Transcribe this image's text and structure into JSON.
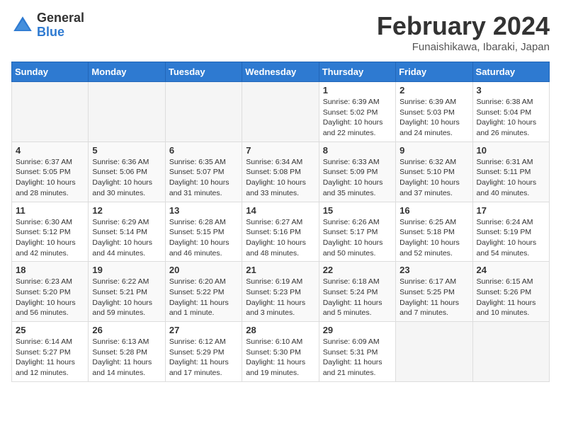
{
  "header": {
    "logo_general": "General",
    "logo_blue": "Blue",
    "month_title": "February 2024",
    "location": "Funaishikawa, Ibaraki, Japan"
  },
  "weekdays": [
    "Sunday",
    "Monday",
    "Tuesday",
    "Wednesday",
    "Thursday",
    "Friday",
    "Saturday"
  ],
  "weeks": [
    [
      {
        "day": "",
        "content": ""
      },
      {
        "day": "",
        "content": ""
      },
      {
        "day": "",
        "content": ""
      },
      {
        "day": "",
        "content": ""
      },
      {
        "day": "1",
        "content": "Sunrise: 6:39 AM\nSunset: 5:02 PM\nDaylight: 10 hours\nand 22 minutes."
      },
      {
        "day": "2",
        "content": "Sunrise: 6:39 AM\nSunset: 5:03 PM\nDaylight: 10 hours\nand 24 minutes."
      },
      {
        "day": "3",
        "content": "Sunrise: 6:38 AM\nSunset: 5:04 PM\nDaylight: 10 hours\nand 26 minutes."
      }
    ],
    [
      {
        "day": "4",
        "content": "Sunrise: 6:37 AM\nSunset: 5:05 PM\nDaylight: 10 hours\nand 28 minutes."
      },
      {
        "day": "5",
        "content": "Sunrise: 6:36 AM\nSunset: 5:06 PM\nDaylight: 10 hours\nand 30 minutes."
      },
      {
        "day": "6",
        "content": "Sunrise: 6:35 AM\nSunset: 5:07 PM\nDaylight: 10 hours\nand 31 minutes."
      },
      {
        "day": "7",
        "content": "Sunrise: 6:34 AM\nSunset: 5:08 PM\nDaylight: 10 hours\nand 33 minutes."
      },
      {
        "day": "8",
        "content": "Sunrise: 6:33 AM\nSunset: 5:09 PM\nDaylight: 10 hours\nand 35 minutes."
      },
      {
        "day": "9",
        "content": "Sunrise: 6:32 AM\nSunset: 5:10 PM\nDaylight: 10 hours\nand 37 minutes."
      },
      {
        "day": "10",
        "content": "Sunrise: 6:31 AM\nSunset: 5:11 PM\nDaylight: 10 hours\nand 40 minutes."
      }
    ],
    [
      {
        "day": "11",
        "content": "Sunrise: 6:30 AM\nSunset: 5:12 PM\nDaylight: 10 hours\nand 42 minutes."
      },
      {
        "day": "12",
        "content": "Sunrise: 6:29 AM\nSunset: 5:14 PM\nDaylight: 10 hours\nand 44 minutes."
      },
      {
        "day": "13",
        "content": "Sunrise: 6:28 AM\nSunset: 5:15 PM\nDaylight: 10 hours\nand 46 minutes."
      },
      {
        "day": "14",
        "content": "Sunrise: 6:27 AM\nSunset: 5:16 PM\nDaylight: 10 hours\nand 48 minutes."
      },
      {
        "day": "15",
        "content": "Sunrise: 6:26 AM\nSunset: 5:17 PM\nDaylight: 10 hours\nand 50 minutes."
      },
      {
        "day": "16",
        "content": "Sunrise: 6:25 AM\nSunset: 5:18 PM\nDaylight: 10 hours\nand 52 minutes."
      },
      {
        "day": "17",
        "content": "Sunrise: 6:24 AM\nSunset: 5:19 PM\nDaylight: 10 hours\nand 54 minutes."
      }
    ],
    [
      {
        "day": "18",
        "content": "Sunrise: 6:23 AM\nSunset: 5:20 PM\nDaylight: 10 hours\nand 56 minutes."
      },
      {
        "day": "19",
        "content": "Sunrise: 6:22 AM\nSunset: 5:21 PM\nDaylight: 10 hours\nand 59 minutes."
      },
      {
        "day": "20",
        "content": "Sunrise: 6:20 AM\nSunset: 5:22 PM\nDaylight: 11 hours\nand 1 minute."
      },
      {
        "day": "21",
        "content": "Sunrise: 6:19 AM\nSunset: 5:23 PM\nDaylight: 11 hours\nand 3 minutes."
      },
      {
        "day": "22",
        "content": "Sunrise: 6:18 AM\nSunset: 5:24 PM\nDaylight: 11 hours\nand 5 minutes."
      },
      {
        "day": "23",
        "content": "Sunrise: 6:17 AM\nSunset: 5:25 PM\nDaylight: 11 hours\nand 7 minutes."
      },
      {
        "day": "24",
        "content": "Sunrise: 6:15 AM\nSunset: 5:26 PM\nDaylight: 11 hours\nand 10 minutes."
      }
    ],
    [
      {
        "day": "25",
        "content": "Sunrise: 6:14 AM\nSunset: 5:27 PM\nDaylight: 11 hours\nand 12 minutes."
      },
      {
        "day": "26",
        "content": "Sunrise: 6:13 AM\nSunset: 5:28 PM\nDaylight: 11 hours\nand 14 minutes."
      },
      {
        "day": "27",
        "content": "Sunrise: 6:12 AM\nSunset: 5:29 PM\nDaylight: 11 hours\nand 17 minutes."
      },
      {
        "day": "28",
        "content": "Sunrise: 6:10 AM\nSunset: 5:30 PM\nDaylight: 11 hours\nand 19 minutes."
      },
      {
        "day": "29",
        "content": "Sunrise: 6:09 AM\nSunset: 5:31 PM\nDaylight: 11 hours\nand 21 minutes."
      },
      {
        "day": "",
        "content": ""
      },
      {
        "day": "",
        "content": ""
      }
    ]
  ]
}
